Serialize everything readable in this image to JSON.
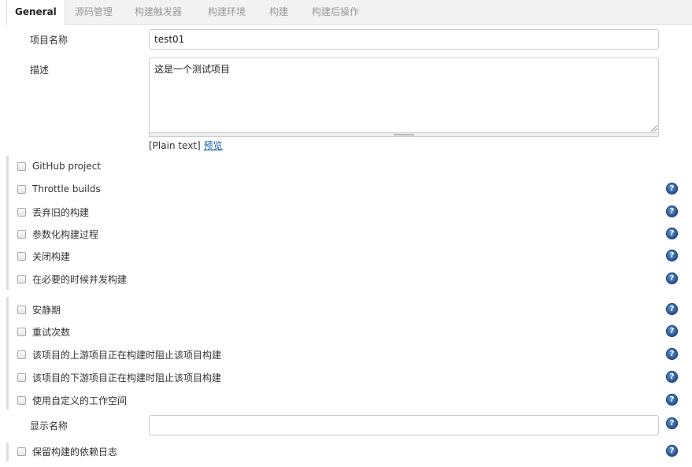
{
  "tabs": [
    {
      "label": "General",
      "active": true
    },
    {
      "label": "源码管理"
    },
    {
      "label": "构建触发器"
    },
    {
      "label": "构建环境"
    },
    {
      "label": "构建"
    },
    {
      "label": "构建后操作"
    }
  ],
  "project_name": {
    "label": "项目名称",
    "value": "test01"
  },
  "description": {
    "label": "描述",
    "value": "这是一个测试项目",
    "format_text": "[Plain text]",
    "preview_link": "预览"
  },
  "options_group1": [
    {
      "label": "GitHub project",
      "help": false
    },
    {
      "label": "Throttle builds",
      "help": true
    },
    {
      "label": "丢弃旧的构建",
      "help": true
    },
    {
      "label": "参数化构建过程",
      "help": true
    },
    {
      "label": "关闭构建",
      "help": true
    },
    {
      "label": "在必要的时候并发构建",
      "help": true
    }
  ],
  "options_group2": [
    {
      "label": "安静期",
      "help": true
    },
    {
      "label": "重试次数",
      "help": true
    },
    {
      "label": "该项目的上游项目正在构建时阻止该项目构建",
      "help": true
    },
    {
      "label": "该项目的下游项目正在构建时阻止该项目构建",
      "help": true
    },
    {
      "label": "使用自定义的工作空间",
      "help": true
    }
  ],
  "display_name": {
    "label": "显示名称",
    "value": ""
  },
  "options_group3": [
    {
      "label": "保留构建的依赖日志",
      "help": true
    }
  ],
  "help_icon_glyph": "?",
  "colors": {
    "link": "#2060b0",
    "help_icon": "#224c8a",
    "tab_bar": "#f2f2f2"
  }
}
